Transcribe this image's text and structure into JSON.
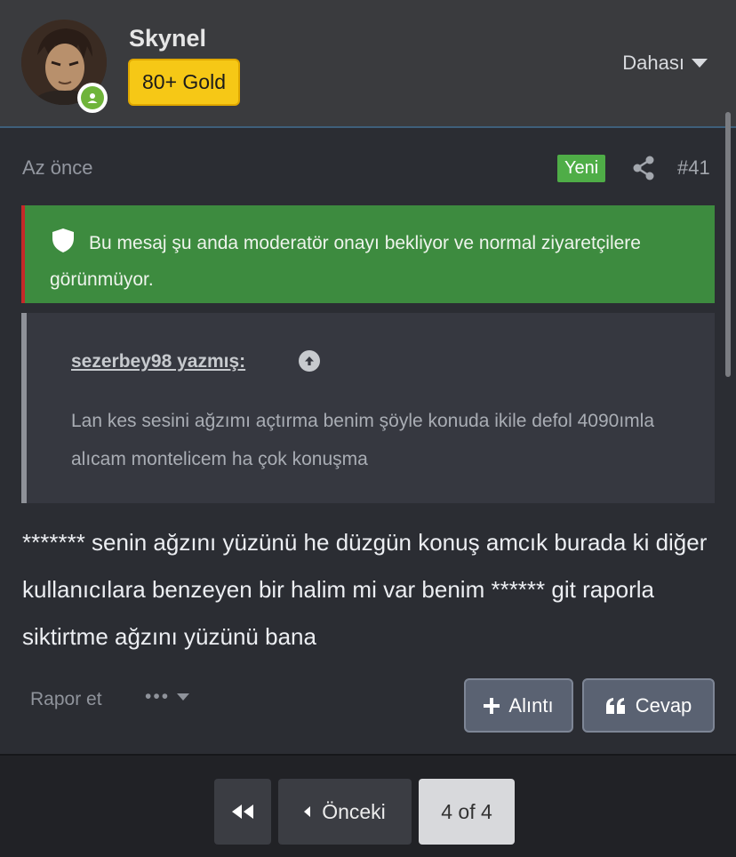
{
  "user": {
    "name": "Skynel",
    "badge": "80+ Gold",
    "online": true
  },
  "header": {
    "more_label": "Dahası"
  },
  "post": {
    "time": "Az önce",
    "new_label": "Yeni",
    "number": "#41",
    "moderation_notice": "Bu mesaj şu anda moderatör onayı bekliyor ve normal ziyaretçilere görünmüyor.",
    "quote": {
      "author": "sezerbey98 yazmış:",
      "text": "Lan kes sesini ağzımı açtırma benim şöyle konuda ikile defol 4090ımla alıcam montelicem ha çok konuşma"
    },
    "body": "******* senin ağzını yüzünü he düzgün konuş amcık burada ki diğer kullanıcılara benzeyen bir halim mi var benim ****** git raporla siktirtme ağzını yüzünü bana",
    "report_label": "Rapor et",
    "more_actions": "•••",
    "quote_button": "Alıntı",
    "reply_button": "Cevap"
  },
  "pagination": {
    "prev_label": "Önceki",
    "current": "4 of 4"
  },
  "colors": {
    "badge_gold": "#f6c816",
    "new_green": "#4fad47",
    "notice_green": "#3d8b3f",
    "online_green": "#6fb43a"
  }
}
